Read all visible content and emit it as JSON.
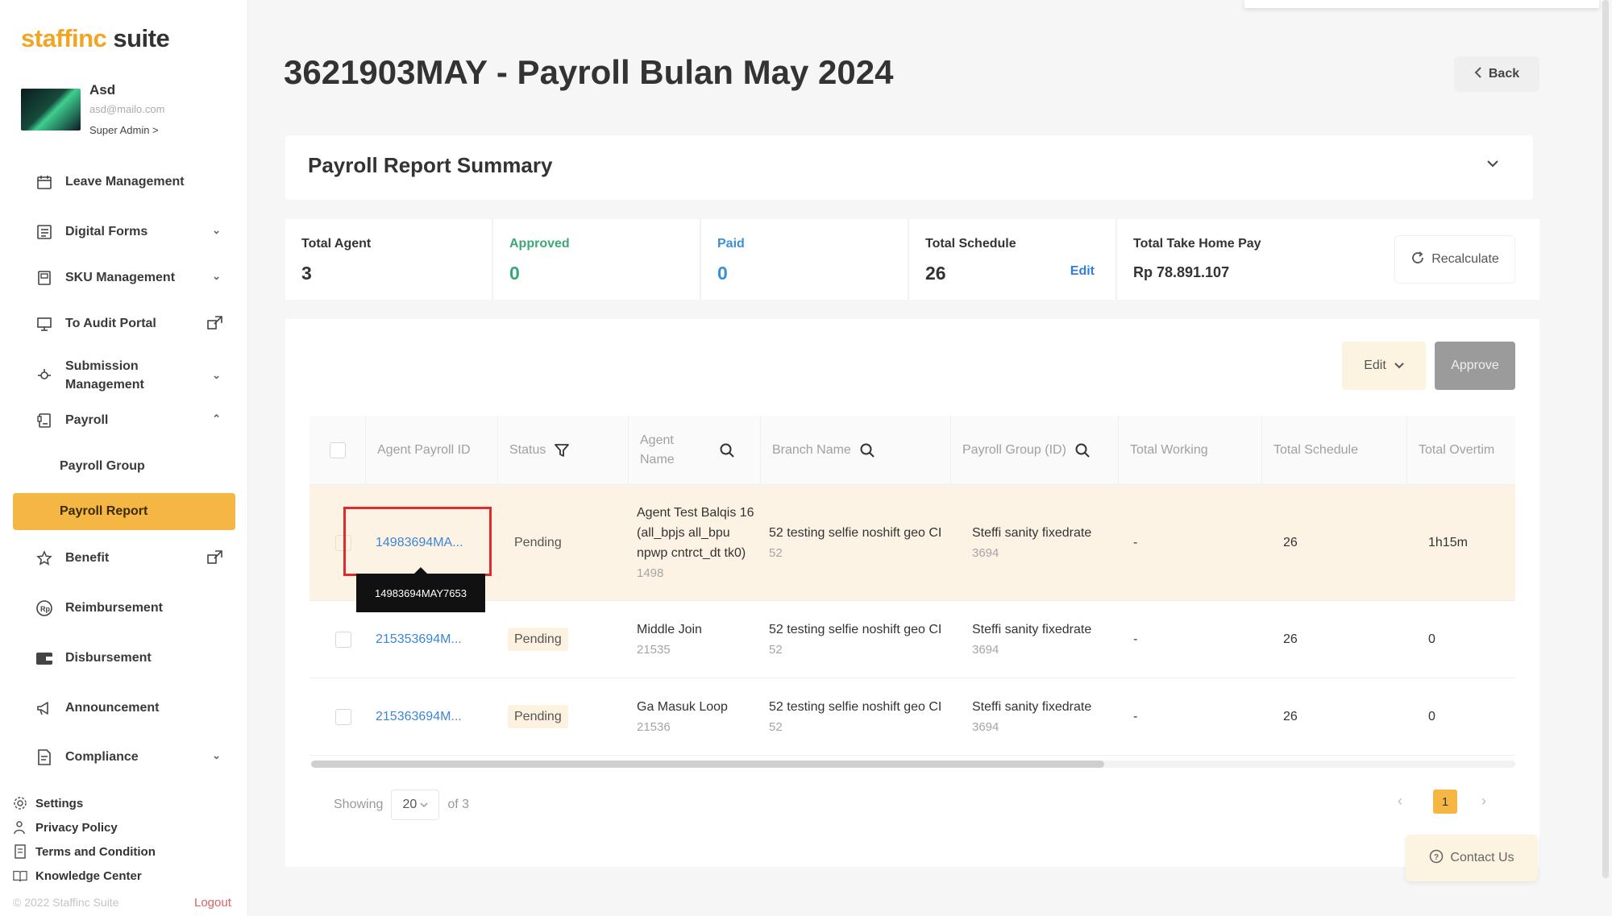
{
  "brand": {
    "name_part1": "staffinc",
    "name_part2": " suite",
    "accent": "#f5b744"
  },
  "profile": {
    "name": "Asd",
    "email": "asd@mailo.com",
    "role": "Super Admin >"
  },
  "sidebar": {
    "items": [
      {
        "label": "Leave Management",
        "icon": "calendar-icon"
      },
      {
        "label": "Digital Forms",
        "icon": "form-icon"
      },
      {
        "label": "SKU Management",
        "icon": "sku-icon"
      },
      {
        "label": "To Audit Portal",
        "icon": "audit-icon"
      },
      {
        "label": "Submission Management",
        "icon": "submission-icon"
      },
      {
        "label": "Payroll",
        "icon": "payroll-icon"
      },
      {
        "label": "Payroll Group"
      },
      {
        "label": "Payroll Report"
      },
      {
        "label": "Benefit",
        "icon": "star-icon"
      },
      {
        "label": "Reimbursement",
        "icon": "reimbursement-icon"
      },
      {
        "label": "Disbursement",
        "icon": "wallet-icon"
      },
      {
        "label": "Announcement",
        "icon": "megaphone-icon"
      },
      {
        "label": "Compliance",
        "icon": "compliance-icon"
      }
    ],
    "footer": [
      "Settings",
      "Privacy Policy",
      "Terms and Condition",
      "Knowledge Center"
    ],
    "copyright": "© 2022 Staffinc Suite",
    "logout": "Logout"
  },
  "page": {
    "title": "3621903MAY - Payroll Bulan May 2024",
    "back": "Back"
  },
  "summary": {
    "title": "Payroll Report Summary",
    "stats": [
      {
        "label": "Total Agent",
        "value": "3"
      },
      {
        "label": "Approved",
        "value": "0"
      },
      {
        "label": "Paid",
        "value": "0"
      },
      {
        "label": "Total Schedule",
        "value": "26",
        "action": "Edit"
      },
      {
        "label": "Total Take Home Pay",
        "value": "Rp 78.891.107"
      }
    ],
    "recalculate": "Recalculate"
  },
  "actions": {
    "edit": "Edit",
    "approve": "Approve"
  },
  "table": {
    "headers": [
      "Agent Payroll ID",
      "Status",
      "Agent Name",
      "Branch Name",
      "Payroll Group (ID)",
      "Total Working",
      "Total Schedule",
      "Total Overtim"
    ],
    "rows": [
      {
        "id": "14983694MA...",
        "status": "Pending",
        "agent_name": "Agent Test Balqis 16 (all_bpjs all_bpu npwp cntrct_dt tk0)",
        "agent_id": "1498",
        "branch": "52 testing selfie noshift geo CI",
        "branch_id": "52",
        "group": "Steffi sanity fixedrate",
        "group_id": "3694",
        "working": "-",
        "schedule": "26",
        "overtime": "1h15m"
      },
      {
        "id": "215353694M...",
        "status": "Pending",
        "agent_name": "Middle Join",
        "agent_id": "21535",
        "branch": "52 testing selfie noshift geo CI",
        "branch_id": "52",
        "group": "Steffi sanity fixedrate",
        "group_id": "3694",
        "working": "-",
        "schedule": "26",
        "overtime": "0"
      },
      {
        "id": "215363694M...",
        "status": "Pending",
        "agent_name": "Ga Masuk Loop",
        "agent_id": "21536",
        "branch": "52 testing selfie noshift geo CI",
        "branch_id": "52",
        "group": "Steffi sanity fixedrate",
        "group_id": "3694",
        "working": "-",
        "schedule": "26",
        "overtime": "0"
      }
    ],
    "tooltip": "14983694MAY7653"
  },
  "pagination": {
    "showing": "Showing",
    "per_page": "20",
    "of": "of 3",
    "current": "1"
  },
  "contact": "Contact Us"
}
